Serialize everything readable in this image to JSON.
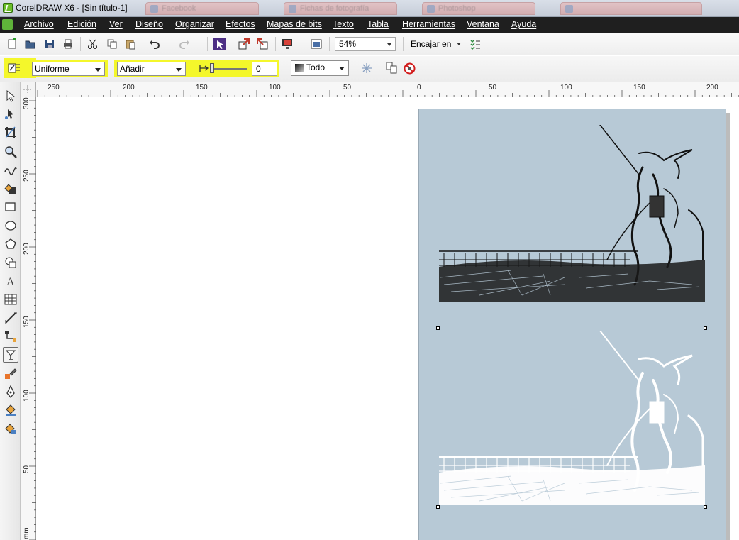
{
  "window": {
    "title": "CorelDRAW X6 - [Sin título-1]",
    "background_tabs": [
      "Facebook",
      "Fichas de fotografía",
      "Photoshop"
    ]
  },
  "menu": {
    "items": [
      "Archivo",
      "Edición",
      "Ver",
      "Diseño",
      "Organizar",
      "Efectos",
      "Mapas de bits",
      "Texto",
      "Tabla",
      "Herramientas",
      "Ventana",
      "Ayuda"
    ]
  },
  "toolbar": {
    "zoom_value": "54%",
    "snap_label": "Encajar en",
    "icons": [
      "new-document-icon",
      "open-icon",
      "save-icon",
      "print-icon",
      "cut-icon",
      "copy-icon",
      "paste-icon",
      "undo-icon",
      "redo-icon",
      "search-content-icon",
      "import-icon",
      "export-icon",
      "publish-pdf-icon",
      "welcome-screen-icon",
      "snap-options-icon"
    ]
  },
  "property_bar": {
    "transparency_type": "Uniforme",
    "merge_mode": "Añadir",
    "transparency_value": "0",
    "target": "Todo",
    "highlight_color": "#f4f72b"
  },
  "rulers": {
    "horizontal_labels": [
      "250",
      "200",
      "150",
      "100",
      "50",
      "0",
      "50",
      "100",
      "150",
      "200"
    ],
    "vertical_labels": [
      "300",
      "250",
      "200",
      "150",
      "100",
      "50"
    ],
    "vertical_unit": "mm"
  },
  "toolbox": {
    "tools": [
      "pick-tool-icon",
      "shape-tool-icon",
      "crop-tool-icon",
      "zoom-tool-icon",
      "freehand-tool-icon",
      "smart-fill-tool-icon",
      "rectangle-tool-icon",
      "ellipse-tool-icon",
      "polygon-tool-icon",
      "basic-shapes-tool-icon",
      "text-tool-icon",
      "table-tool-icon",
      "parallel-dimension-tool-icon",
      "connector-tool-icon",
      "transparency-tool-icon",
      "eyedropper-tool-icon",
      "outline-pen-tool-icon",
      "fill-tool-icon",
      "interactive-fill-tool-icon"
    ],
    "active_tool": "transparency-tool-icon"
  },
  "document": {
    "page_color": "#b7c9d6",
    "images": [
      "black-sketch-illustration",
      "white-sketch-illustration"
    ]
  }
}
